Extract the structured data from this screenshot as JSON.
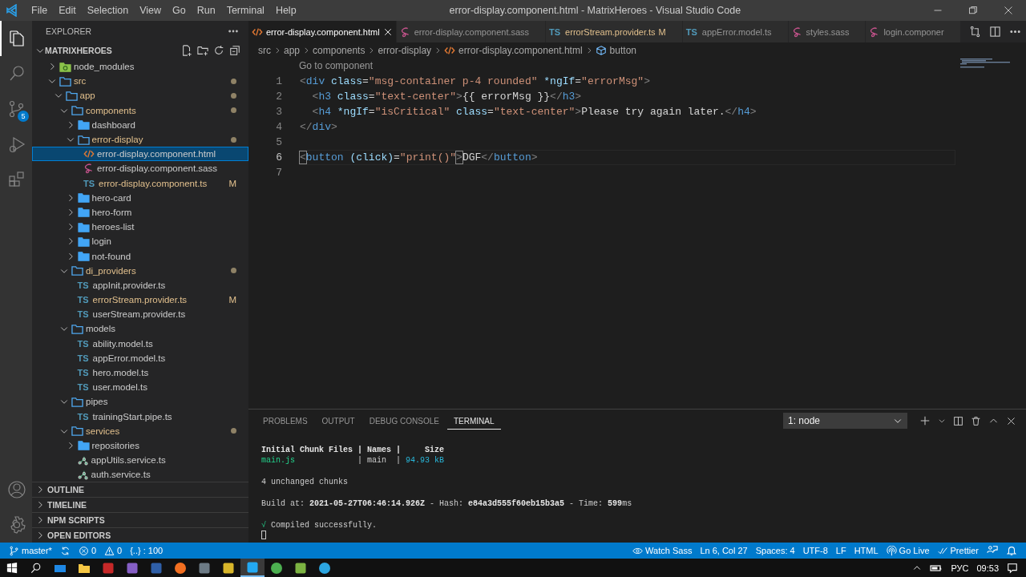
{
  "window": {
    "title": "error-display.component.html - MatrixHeroes - Visual Studio Code",
    "menu": [
      "File",
      "Edit",
      "Selection",
      "View",
      "Go",
      "Run",
      "Terminal",
      "Help"
    ]
  },
  "activity_bar": [
    {
      "kind": "explorer",
      "selected": true
    },
    {
      "kind": "search",
      "selected": false
    },
    {
      "kind": "source_control",
      "selected": false,
      "badge": "5"
    },
    {
      "kind": "run",
      "selected": false
    },
    {
      "kind": "extensions",
      "selected": false
    }
  ],
  "activity_bar_bottom": [
    {
      "kind": "account"
    },
    {
      "kind": "settings"
    }
  ],
  "sidebar": {
    "title": "EXPLORER",
    "root": "MATRIXHEROES",
    "tree": [
      {
        "label": "node_modules",
        "kind": "package_folder",
        "expanded": false,
        "modified": false,
        "selected": false
      },
      {
        "label": "src",
        "kind": "folder",
        "expanded": true,
        "modified": true,
        "selected": false,
        "children": [
          {
            "label": "app",
            "kind": "folder",
            "expanded": true,
            "modified": true,
            "selected": false,
            "children": [
              {
                "label": "components",
                "kind": "folder",
                "expanded": true,
                "modified": true,
                "selected": false,
                "children": [
                  {
                    "label": "dashboard",
                    "kind": "folder",
                    "expanded": false,
                    "modified": false,
                    "selected": false
                  },
                  {
                    "label": "error-display",
                    "kind": "folder",
                    "expanded": true,
                    "modified": true,
                    "selected": false,
                    "children": [
                      {
                        "label": "error-display.component.html",
                        "kind": "html_file",
                        "modified": false,
                        "selected": true
                      },
                      {
                        "label": "error-display.component.sass",
                        "kind": "sass_file",
                        "modified": false,
                        "selected": false
                      },
                      {
                        "label": "error-display.component.ts",
                        "kind": "ts_file",
                        "icon_text": "TS",
                        "modified": true,
                        "badge": "M",
                        "selected": false
                      }
                    ]
                  },
                  {
                    "label": "hero-card",
                    "kind": "folder",
                    "expanded": false,
                    "modified": false,
                    "selected": false
                  },
                  {
                    "label": "hero-form",
                    "kind": "folder",
                    "expanded": false,
                    "modified": false,
                    "selected": false
                  },
                  {
                    "label": "heroes-list",
                    "kind": "folder",
                    "expanded": false,
                    "modified": false,
                    "selected": false
                  },
                  {
                    "label": "login",
                    "kind": "folder",
                    "expanded": false,
                    "modified": false,
                    "selected": false
                  },
                  {
                    "label": "not-found",
                    "kind": "folder",
                    "expanded": false,
                    "modified": false,
                    "selected": false
                  }
                ]
              },
              {
                "label": "di_providers",
                "kind": "folder",
                "expanded": true,
                "modified": true,
                "selected": false,
                "children": [
                  {
                    "label": "appInit.provider.ts",
                    "kind": "ts_file",
                    "icon_text": "TS",
                    "modified": false,
                    "selected": false
                  },
                  {
                    "label": "errorStream.provider.ts",
                    "kind": "ts_file",
                    "icon_text": "TS",
                    "modified": true,
                    "badge": "M",
                    "selected": false
                  },
                  {
                    "label": "userStream.provider.ts",
                    "kind": "ts_file",
                    "icon_text": "TS",
                    "modified": false,
                    "selected": false
                  }
                ]
              },
              {
                "label": "models",
                "kind": "folder",
                "expanded": true,
                "modified": false,
                "selected": false,
                "children": [
                  {
                    "label": "ability.model.ts",
                    "kind": "ts_file",
                    "icon_text": "TS",
                    "modified": false,
                    "selected": false
                  },
                  {
                    "label": "appError.model.ts",
                    "kind": "ts_file",
                    "icon_text": "TS",
                    "modified": false,
                    "selected": false
                  },
                  {
                    "label": "hero.model.ts",
                    "kind": "ts_file",
                    "icon_text": "TS",
                    "modified": false,
                    "selected": false
                  },
                  {
                    "label": "user.model.ts",
                    "kind": "ts_file",
                    "icon_text": "TS",
                    "modified": false,
                    "selected": false
                  }
                ]
              },
              {
                "label": "pipes",
                "kind": "folder",
                "expanded": true,
                "modified": false,
                "selected": false,
                "children": [
                  {
                    "label": "trainingStart.pipe.ts",
                    "kind": "ts_file",
                    "icon_text": "TS",
                    "modified": false,
                    "selected": false
                  }
                ]
              },
              {
                "label": "services",
                "kind": "folder",
                "expanded": true,
                "modified": true,
                "selected": false,
                "children": [
                  {
                    "label": "repositories",
                    "kind": "folder",
                    "expanded": false,
                    "modified": false,
                    "selected": false
                  },
                  {
                    "label": "appUtils.service.ts",
                    "kind": "service_file",
                    "modified": false,
                    "selected": false
                  },
                  {
                    "label": "auth.service.ts",
                    "kind": "service_file",
                    "modified": false,
                    "selected": false
                  }
                ]
              }
            ]
          }
        ]
      }
    ],
    "sections": [
      "OUTLINE",
      "TIMELINE",
      "NPM SCRIPTS",
      "OPEN EDITORS"
    ]
  },
  "tabs": [
    {
      "label": "error-display.component.html",
      "kind": "html_file",
      "selected": true,
      "modified": false
    },
    {
      "label": "error-display.component.sass",
      "kind": "sass_file",
      "selected": false,
      "modified": false
    },
    {
      "label": "errorStream.provider.ts",
      "kind": "ts_file",
      "icon_text": "TS",
      "selected": false,
      "modified": true,
      "badge": "M"
    },
    {
      "label": "appError.model.ts",
      "kind": "ts_file",
      "icon_text": "TS",
      "selected": false,
      "modified": false
    },
    {
      "label": "styles.sass",
      "kind": "sass_file",
      "selected": false,
      "modified": false
    },
    {
      "label": "login.componer",
      "kind": "sass_file",
      "selected": false,
      "modified": false
    }
  ],
  "breadcrumbs": [
    {
      "label": "src",
      "kind": "folder"
    },
    {
      "label": "app",
      "kind": "folder"
    },
    {
      "label": "components",
      "kind": "folder"
    },
    {
      "label": "error-display",
      "kind": "folder"
    },
    {
      "label": "error-display.component.html",
      "kind": "html_file"
    },
    {
      "label": "button",
      "kind": "symbol"
    }
  ],
  "editor": {
    "codelens": "Go to component",
    "lines": [
      {
        "number": "1",
        "current": false,
        "tokens": [
          {
            "kind": "punct",
            "text": "<"
          },
          {
            "kind": "tag",
            "text": "div"
          },
          {
            "kind": "attr",
            "text": " class"
          },
          {
            "kind": "text",
            "text": "="
          },
          {
            "kind": "str",
            "text": "\"msg-container p-4 rounded\""
          },
          {
            "kind": "attr",
            "text": " *ngIf"
          },
          {
            "kind": "text",
            "text": "="
          },
          {
            "kind": "str",
            "text": "\"errorMsg\""
          },
          {
            "kind": "punct",
            "text": ">"
          }
        ]
      },
      {
        "number": "2",
        "current": false,
        "tokens": [
          {
            "kind": "punct",
            "text": "  <"
          },
          {
            "kind": "tag",
            "text": "h3"
          },
          {
            "kind": "attr",
            "text": " class"
          },
          {
            "kind": "text",
            "text": "="
          },
          {
            "kind": "str",
            "text": "\"text-center\""
          },
          {
            "kind": "punct",
            "text": ">"
          },
          {
            "kind": "text",
            "text": "{{ errorMsg }}"
          },
          {
            "kind": "punct",
            "text": "</"
          },
          {
            "kind": "tag",
            "text": "h3"
          },
          {
            "kind": "punct",
            "text": ">"
          }
        ]
      },
      {
        "number": "3",
        "current": false,
        "tokens": [
          {
            "kind": "punct",
            "text": "  <"
          },
          {
            "kind": "tag",
            "text": "h4"
          },
          {
            "kind": "attr",
            "text": " *ngIf"
          },
          {
            "kind": "text",
            "text": "="
          },
          {
            "kind": "str",
            "text": "\"isCritical\""
          },
          {
            "kind": "attr",
            "text": " class"
          },
          {
            "kind": "text",
            "text": "="
          },
          {
            "kind": "str",
            "text": "\"text-center\""
          },
          {
            "kind": "punct",
            "text": ">"
          },
          {
            "kind": "text",
            "text": "Please try again later."
          },
          {
            "kind": "punct",
            "text": "</"
          },
          {
            "kind": "tag",
            "text": "h4"
          },
          {
            "kind": "punct",
            "text": ">"
          }
        ]
      },
      {
        "number": "4",
        "current": false,
        "tokens": [
          {
            "kind": "punct",
            "text": "</"
          },
          {
            "kind": "tag",
            "text": "div"
          },
          {
            "kind": "punct",
            "text": ">"
          }
        ]
      },
      {
        "number": "5",
        "current": false
      },
      {
        "number": "6",
        "current": true,
        "tokens": [
          {
            "kind": "match",
            "text": "<"
          },
          {
            "kind": "tag",
            "text": "button"
          },
          {
            "kind": "attr",
            "text": " (click)"
          },
          {
            "kind": "text",
            "text": "="
          },
          {
            "kind": "str",
            "text": "\"print()\""
          },
          {
            "kind": "match",
            "text": ">"
          },
          {
            "kind": "text",
            "text": "DGF"
          },
          {
            "kind": "punct",
            "text": "</"
          },
          {
            "kind": "tag",
            "text": "button"
          },
          {
            "kind": "punct",
            "text": ">"
          }
        ]
      },
      {
        "number": "7",
        "current": false
      }
    ]
  },
  "panel": {
    "tabs": [
      {
        "label": "PROBLEMS",
        "selected": false
      },
      {
        "label": "OUTPUT",
        "selected": false
      },
      {
        "label": "DEBUG CONSOLE",
        "selected": false
      },
      {
        "label": "TERMINAL",
        "selected": true
      }
    ],
    "terminal_select": "1: node",
    "terminal": [
      {
        "tokens": [
          {
            "kind": "bold",
            "text": "Initial Chunk Files | Names |     Size"
          }
        ]
      },
      {
        "tokens": [
          {
            "kind": "green",
            "text": "main.js"
          },
          {
            "kind": "plain",
            "text": "             | main  | "
          },
          {
            "kind": "cyan",
            "text": "94.93 kB"
          }
        ]
      },
      {
        "space_before": true,
        "tokens": [
          {
            "kind": "plain",
            "text": "4 unchanged chunks"
          }
        ]
      },
      {
        "space_before": true,
        "tokens": [
          {
            "kind": "plain",
            "text": "Build at: "
          },
          {
            "kind": "bold",
            "text": "2021-05-27T06:46:14.926Z"
          },
          {
            "kind": "plain",
            "text": " - Hash: "
          },
          {
            "kind": "bold",
            "text": "e84a3d555f60eb15b3a5"
          },
          {
            "kind": "plain",
            "text": " - Time: "
          },
          {
            "kind": "bold",
            "text": "599"
          },
          {
            "kind": "plain",
            "text": "ms"
          }
        ]
      },
      {
        "space_before": true,
        "tokens": [
          {
            "kind": "green",
            "text": "√"
          },
          {
            "kind": "plain",
            "text": " Compiled successfully."
          }
        ]
      }
    ]
  },
  "status_bar": {
    "left": [
      {
        "kind": "branch",
        "text": "master*"
      },
      {
        "kind": "sync"
      },
      {
        "kind": "errors",
        "text": "0"
      },
      {
        "kind": "warnings",
        "text": "0"
      },
      {
        "kind": "plain",
        "text": "{..} : 100"
      }
    ],
    "right": [
      {
        "kind": "eye",
        "text": "Watch Sass"
      },
      {
        "kind": "plain",
        "text": "Ln 6, Col 27"
      },
      {
        "kind": "plain",
        "text": "Spaces: 4"
      },
      {
        "kind": "plain",
        "text": "UTF-8"
      },
      {
        "kind": "plain",
        "text": "LF"
      },
      {
        "kind": "plain",
        "text": "HTML"
      },
      {
        "kind": "broadcast",
        "text": "Go Live"
      },
      {
        "kind": "check",
        "text": "Prettier"
      },
      {
        "kind": "feedback"
      },
      {
        "kind": "bell"
      }
    ]
  },
  "taskbar": {
    "apps": [
      {
        "kind": "mail",
        "color": "#1e88e5",
        "selected": false
      },
      {
        "kind": "folder",
        "color": "#f6c744",
        "selected": false
      },
      {
        "kind": "square",
        "color": "#c62828",
        "selected": false
      },
      {
        "kind": "square",
        "color": "#865fc5",
        "selected": false
      },
      {
        "kind": "square",
        "color": "#2f5fa7",
        "selected": false
      },
      {
        "kind": "circle",
        "color": "#f26f21",
        "selected": false
      },
      {
        "kind": "square",
        "color": "#6d7b86",
        "selected": false
      },
      {
        "kind": "square",
        "color": "#d8b62a",
        "selected": false
      },
      {
        "kind": "square",
        "color": "#23a9f2",
        "selected": true
      },
      {
        "kind": "circle",
        "color": "#4caf50",
        "selected": false
      },
      {
        "kind": "square",
        "color": "#7cb342",
        "selected": false
      },
      {
        "kind": "circle",
        "color": "#2ca5e0",
        "selected": false
      }
    ],
    "language": "РУС",
    "time": "09:53"
  }
}
